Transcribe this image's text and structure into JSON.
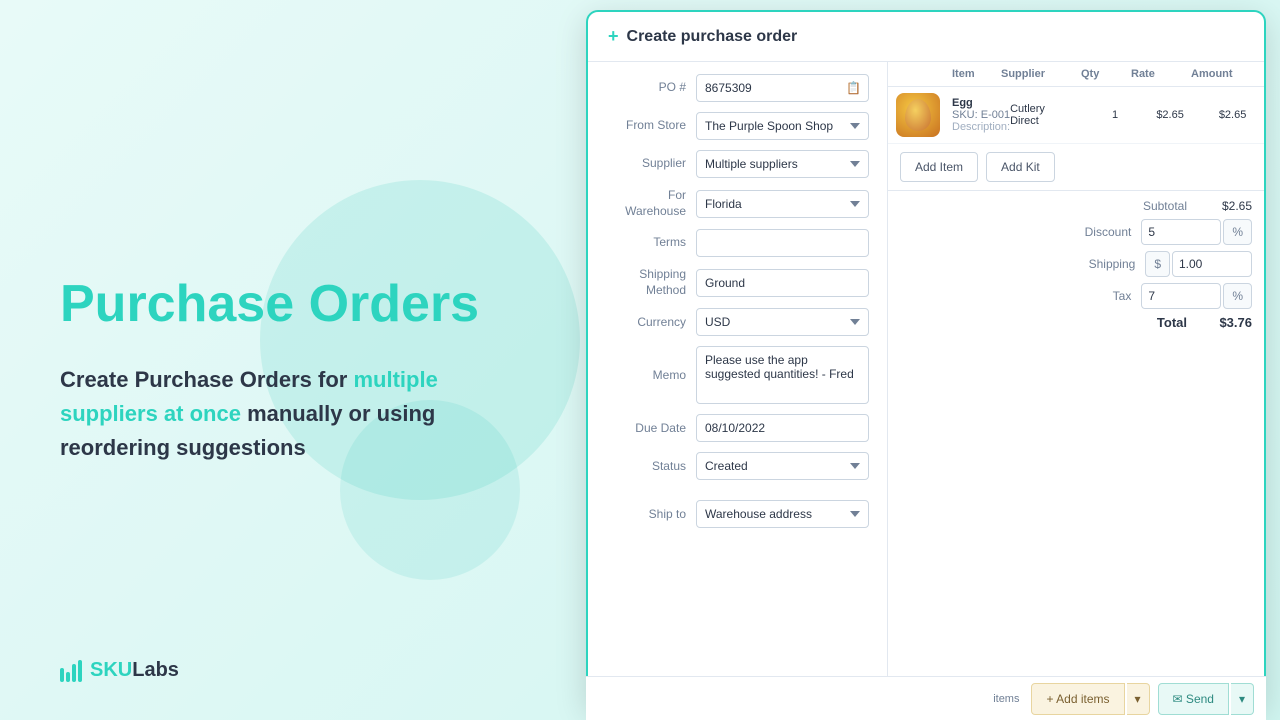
{
  "left": {
    "title_line1": "Purchase Orders",
    "subtitle_part1": "Create Purchase Orders for ",
    "subtitle_highlight1": "multiple",
    "subtitle_part2": " ",
    "subtitle_highlight2": "suppliers at once",
    "subtitle_part3": " manually or using",
    "subtitle_line2": "reordering suggestions",
    "logo_text_sku": "SKU",
    "logo_text_labs": "Labs"
  },
  "modal": {
    "title": "Create purchase order",
    "form": {
      "po_label": "PO #",
      "po_value": "8675309",
      "from_store_label": "From Store",
      "from_store_value": "The Purple Spoon Shop",
      "supplier_label": "Supplier",
      "supplier_value": "Multiple suppliers",
      "for_warehouse_label": "For Warehouse",
      "for_warehouse_value": "Florida",
      "terms_label": "Terms",
      "terms_value": "",
      "shipping_method_label": "Shipping Method",
      "shipping_method_value": "Ground",
      "currency_label": "Currency",
      "currency_value": "USD",
      "memo_label": "Memo",
      "memo_value": "Please use the app suggested quantities! - Fred",
      "due_date_label": "Due Date",
      "due_date_value": "08/10/2022",
      "status_label": "Status",
      "status_value": "Created",
      "ship_to_label": "Ship to",
      "ship_to_value": "Warehouse address"
    },
    "table": {
      "headers": [
        "",
        "Item",
        "Supplier",
        "Qty",
        "Rate",
        "Amount"
      ],
      "rows": [
        {
          "item_name": "Egg",
          "item_sku": "SKU: E-001",
          "item_desc": "Description:",
          "supplier": "Cutlery Direct",
          "qty": "1",
          "rate": "$2.65",
          "amount": "$2.65"
        }
      ]
    },
    "totals": {
      "subtotal_label": "Subtotal",
      "subtotal_value": "$2.65",
      "discount_label": "Discount",
      "discount_value": "5",
      "discount_type": "%",
      "shipping_label": "Shipping",
      "shipping_currency": "$",
      "shipping_value": "1.00",
      "tax_label": "Tax",
      "tax_value": "7",
      "tax_type": "%",
      "total_label": "Total",
      "total_value": "$3.76"
    },
    "buttons": {
      "add_item": "Add Item",
      "add_kit": "Add Kit"
    },
    "bottom": {
      "items_count": "items",
      "add_items_label": "+ Add items",
      "send_label": "✉ Send"
    }
  }
}
